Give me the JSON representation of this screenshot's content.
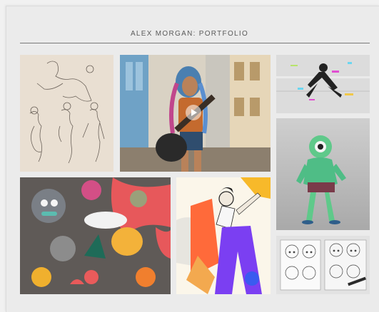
{
  "page": {
    "title": "ALEX MORGAN: PORTFOLIO"
  },
  "gallery": {
    "items": [
      {
        "id": "figure-sketches",
        "subject": "pencil figure studies"
      },
      {
        "id": "guitarist-photo",
        "subject": "woman with guitar",
        "has_play_icon": true
      },
      {
        "id": "glitch-dancer",
        "subject": "jumping dancer glitch art"
      },
      {
        "id": "doodle-pattern",
        "subject": "colorful monster doodles"
      },
      {
        "id": "illustrated-woman",
        "subject": "collage illustration"
      },
      {
        "id": "green-character",
        "subject": "3d green creature"
      },
      {
        "id": "manga-sketchbook",
        "subject": "manga character sketches"
      }
    ]
  },
  "colors": {
    "background": "#ebebeb",
    "rule": "#7a7a7a",
    "title": "#5a5a5a"
  }
}
